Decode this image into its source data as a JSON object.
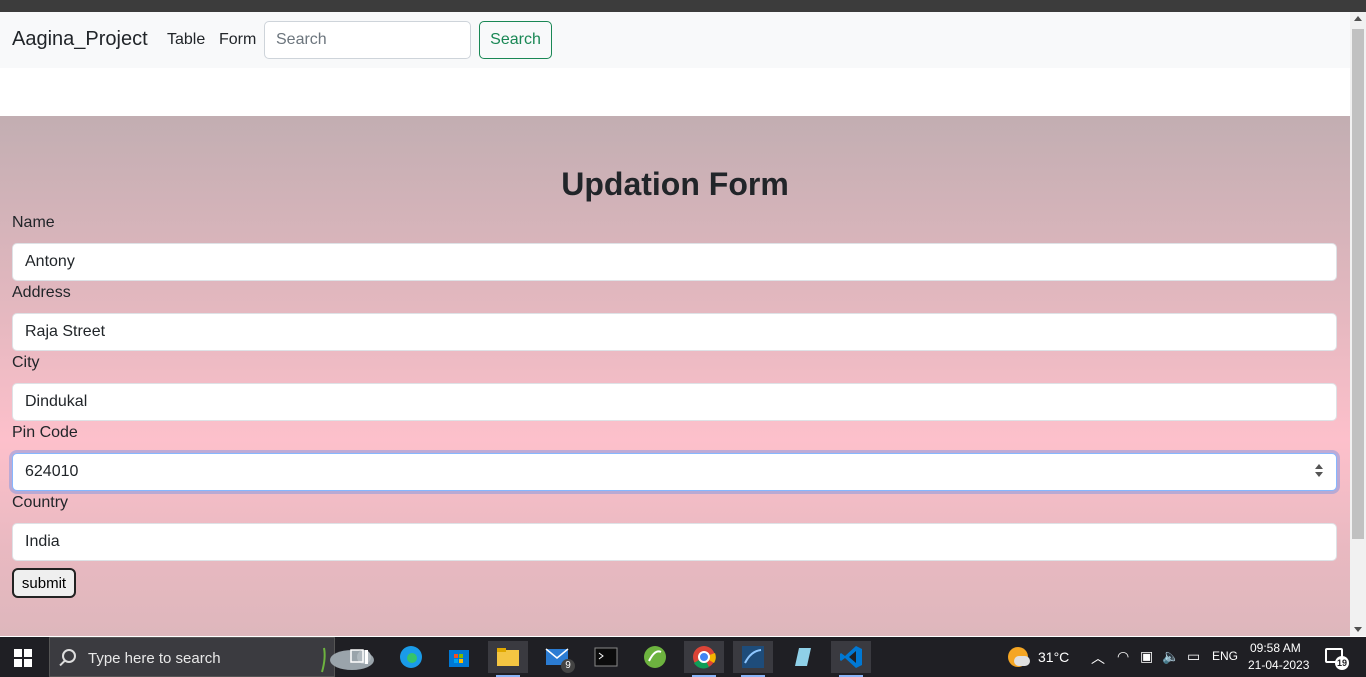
{
  "navbar": {
    "brand": "Aagina_Project",
    "links": [
      "Table",
      "Form"
    ],
    "search_placeholder": "Search",
    "search_button": "Search"
  },
  "form": {
    "title": "Updation Form",
    "fields": [
      {
        "label": "Name",
        "value": "Antony"
      },
      {
        "label": "Address",
        "value": "Raja Street"
      },
      {
        "label": "City",
        "value": "Dindukal"
      },
      {
        "label": "Pin Code",
        "value": "624010"
      },
      {
        "label": "Country",
        "value": "India"
      }
    ],
    "submit_label": "submit"
  },
  "taskbar": {
    "search_placeholder": "Type here to search",
    "mail_badge": "9",
    "weather": "31°C",
    "language": "ENG",
    "time": "09:58 AM",
    "date": "21-04-2023",
    "notification_count": "19"
  },
  "colors": {
    "success": "#198754",
    "navbar_bg": "#f8f9fa",
    "form_bg_top": "#c2aeb2",
    "form_bg_mid": "#fdc0cb"
  }
}
